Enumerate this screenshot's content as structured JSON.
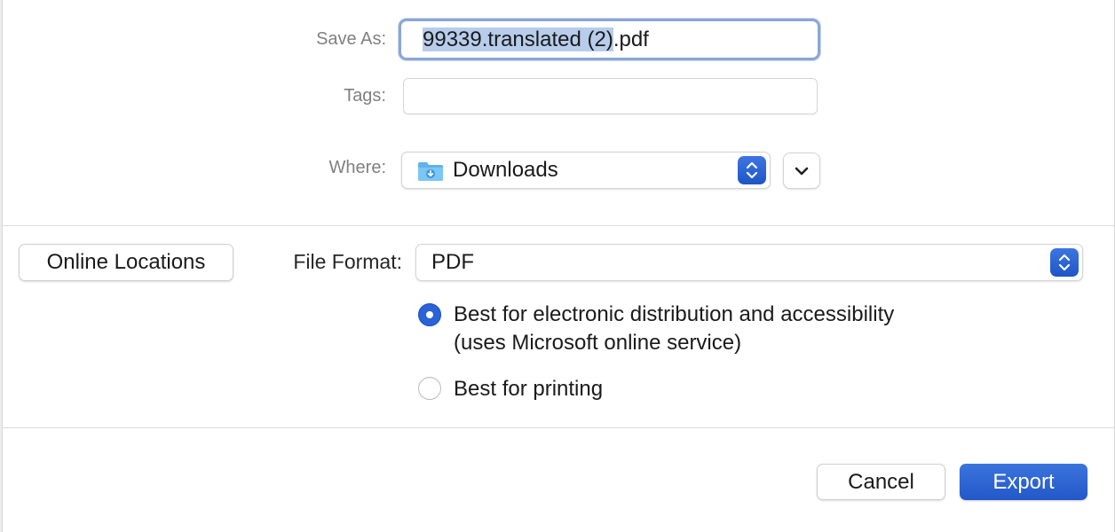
{
  "save_as": {
    "label": "Save As:",
    "value_selected": "99339.translated (2)",
    "value_extension": ".pdf"
  },
  "tags": {
    "label": "Tags:",
    "value": ""
  },
  "where": {
    "label": "Where:",
    "value": "Downloads",
    "icon": "downloads-folder-icon"
  },
  "online_locations_label": "Online Locations",
  "file_format": {
    "label": "File Format:",
    "value": "PDF"
  },
  "options": [
    {
      "line1": "Best for electronic distribution and accessibility",
      "line2": "(uses Microsoft online service)",
      "selected": true
    },
    {
      "line1": "Best for printing",
      "selected": false
    }
  ],
  "buttons": {
    "cancel": "Cancel",
    "export": "Export"
  },
  "colors": {
    "accent": "#2a62d8",
    "selection": "#b7cdeb",
    "focus_ring": "#8aa6d6"
  }
}
